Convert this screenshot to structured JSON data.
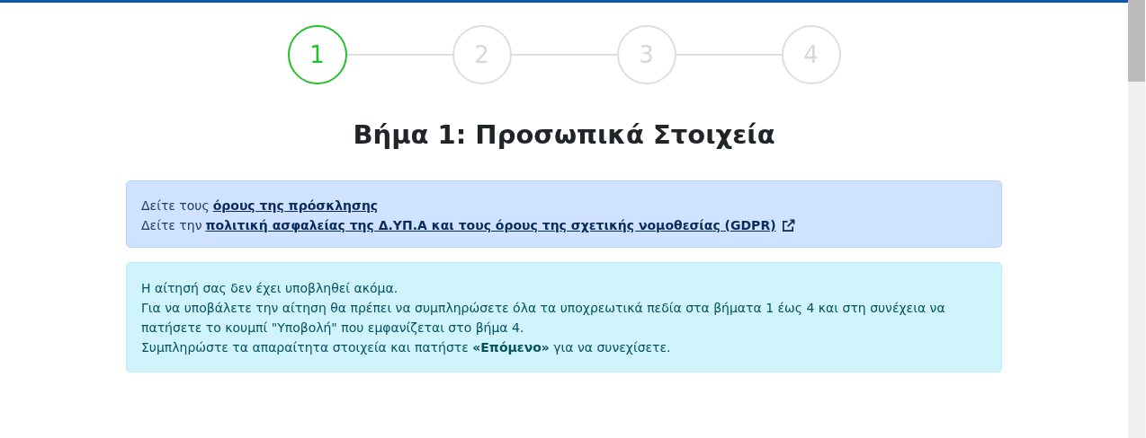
{
  "steps": [
    {
      "label": "1",
      "selected": true
    },
    {
      "label": "2",
      "selected": false
    },
    {
      "label": "3",
      "selected": false
    },
    {
      "label": "4",
      "selected": false
    }
  ],
  "heading": "Βήμα 1: Προσωπικά Στοιχεία",
  "info_box": {
    "lines": [
      {
        "text": "Δείτε τους",
        "link": "όρους της πρόσκλησης",
        "external": false
      },
      {
        "text": "Δείτε την",
        "link": "πολιτική ασφαλείας της Δ.ΥΠ.Α και τους όρους της σχετικής νομοθεσίας (GDPR)",
        "external": true
      }
    ]
  },
  "notice_box": {
    "lines": [
      "Η αίτησή σας δεν έχει υποβληθεί ακόμα.",
      "Για να υποβάλετε την αίτηση θα πρέπει να συμπληρώσετε όλα τα υποχρεωτικά πεδία στα βήματα 1 έως 4 και στη συνέχεια να πατήσετε το κουμπί \"Υποβολή\" που εμφανίζεται στο βήμα 4.",
      "Συμπληρώστε τα απαραίτητα στοιχεία και πατήστε **«Επόμενο»** για να συνεχίσετε."
    ]
  }
}
